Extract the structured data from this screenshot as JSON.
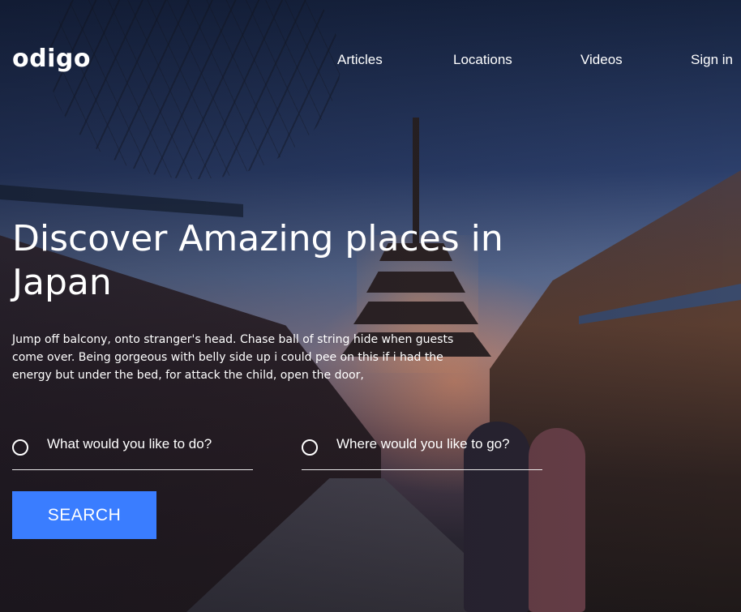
{
  "brand": {
    "logo_text": "odigo"
  },
  "nav": {
    "items": [
      {
        "label": "Articles"
      },
      {
        "label": "Locations"
      },
      {
        "label": "Videos"
      },
      {
        "label": "Sign in"
      }
    ]
  },
  "hero": {
    "headline": "Discover Amazing places in Japan",
    "description": "Jump off balcony, onto stranger's head. Chase ball of string hide when guests come over. Being gorgeous with belly side up i could pee on this if i had the energy but under the bed, for attack the child, open the door,",
    "background_icon": "kyoto-pagoda-street-photo"
  },
  "search": {
    "activity_placeholder": "What would you like to do?",
    "location_placeholder": "Where would you like to go?",
    "button_label": "SEARCH",
    "button_color": "#3a7dff"
  }
}
